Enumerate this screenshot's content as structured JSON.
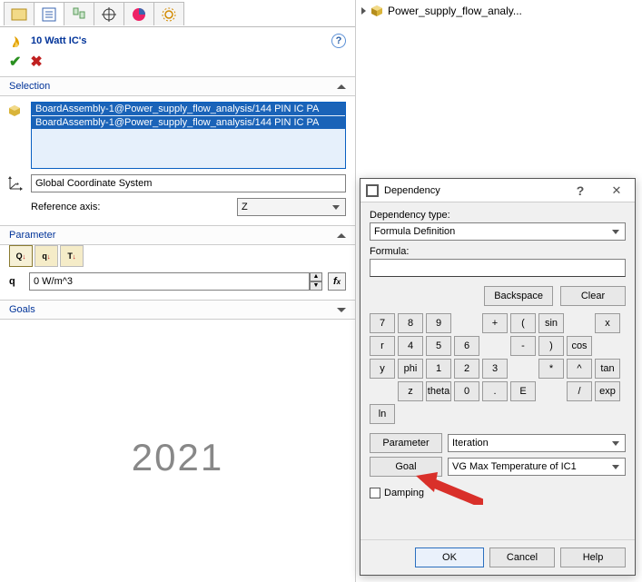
{
  "tree": {
    "root": "Power_supply_flow_analy..."
  },
  "header": {
    "title": "10 Watt IC's"
  },
  "selection": {
    "label": "Selection",
    "items": [
      "BoardAssembly-1@Power_supply_flow_analysis/144 PIN IC PA",
      "BoardAssembly-1@Power_supply_flow_analysis/144 PIN IC PA"
    ],
    "coord_system": "Global Coordinate System",
    "ref_axis_label": "Reference axis:",
    "ref_axis_value": "Z"
  },
  "parameter": {
    "label": "Parameter",
    "q_label": "q",
    "q_value": "0 W/m^3"
  },
  "goals": {
    "label": "Goals"
  },
  "watermark": "2021",
  "dialog": {
    "title": "Dependency",
    "dep_type_label": "Dependency type:",
    "dep_type_value": "Formula Definition",
    "formula_label": "Formula:",
    "formula_value": "",
    "btn_backspace": "Backspace",
    "btn_clear": "Clear",
    "keypad": [
      [
        "7",
        "8",
        "9",
        "",
        "+",
        "(",
        "sin",
        "",
        "x",
        "r"
      ],
      [
        "4",
        "5",
        "6",
        "",
        "-",
        ")",
        "cos",
        "",
        "y",
        "phi"
      ],
      [
        "1",
        "2",
        "3",
        "",
        "*",
        "^",
        "tan",
        "",
        "z",
        "theta"
      ],
      [
        "0",
        ".",
        "E",
        "",
        "/",
        "exp",
        "ln",
        "",
        "",
        ""
      ]
    ],
    "btn_parameter": "Parameter",
    "param_value": "Iteration",
    "btn_goal": "Goal",
    "goal_value": "VG Max Temperature of IC1",
    "damping_label": "Damping",
    "btn_ok": "OK",
    "btn_cancel": "Cancel",
    "btn_help": "Help"
  }
}
